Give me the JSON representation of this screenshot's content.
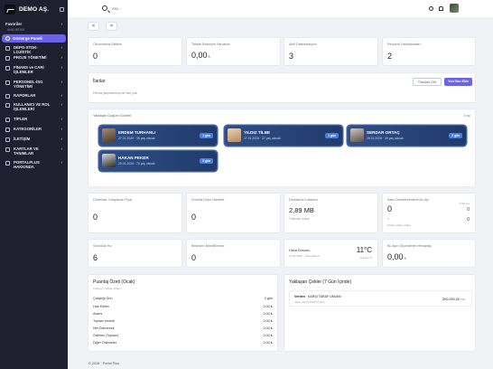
{
  "brand": {
    "name": "DEMO AŞ."
  },
  "sidebar": {
    "favorites": "Favoriler",
    "section_label": "ANA MENÜ",
    "active": "Gösterge Paneli",
    "items": [
      {
        "label": "DEPO-STOK-LOJİSTİK"
      },
      {
        "label": "PROJE YÖNETİMİ"
      },
      {
        "label": "FİNANS ve CARİ İŞLEMLER"
      },
      {
        "label": "PERSONEL-İSG YÖNETİMİ"
      },
      {
        "label": "RAPORLAR"
      },
      {
        "label": "KULLANICI VE ROL İŞLEMLERİ"
      },
      {
        "label": "TİPLER"
      },
      {
        "label": "KATEGORİLER"
      },
      {
        "label": "İLETİŞİM"
      },
      {
        "label": "KARTLAR VE TANIMLAR"
      },
      {
        "label": "PORTALPLUS HAKKINDA"
      }
    ]
  },
  "search": {
    "placeholder": "Ara..."
  },
  "nav": {
    "back": "«",
    "forward": "»"
  },
  "stats_top": [
    {
      "label": "Okunmamış Bildirim",
      "value": "0",
      "unit": ""
    },
    {
      "label": "Tahsile Bekleyen Harcama",
      "value": "0,00",
      "unit": "₺"
    },
    {
      "label": "Aktif Dakimatasyon",
      "value": "3",
      "unit": ""
    },
    {
      "label": "Personel Hatırlatmaları",
      "value": "2",
      "unit": ""
    }
  ],
  "announcements": {
    "title": "İlanlar",
    "empty_text": "Henüz yayınlanmış bir ilan yok",
    "btn_all": "Tümünü Gör",
    "btn_new": "Yeni İlan Ekle"
  },
  "birthdays": {
    "title": "Yaklaşan Doğum Günleri",
    "count": "4 kişi",
    "people": [
      {
        "name": "ERDEM TURHANLI",
        "date": "27.01.2026 · 35 yaş olacak",
        "badge": "1 gün"
      },
      {
        "name": "YILDIZ TİLBE",
        "date": "27.01.2026 · 37 yaş olacak",
        "badge": "1 gün"
      },
      {
        "name": "SERDAR ORTAÇ",
        "date": "28.01.2026 · 39 yaş olacak",
        "badge": "2 gün"
      },
      {
        "name": "HAKAN PEKER",
        "date": "29.01.2026 · 70 yaş olacak",
        "badge": "3 gün"
      }
    ]
  },
  "stats_mid": [
    {
      "label": "Dönemsiz Onaylanan Fiyat",
      "value": "0"
    },
    {
      "label": "Ürünlük Depo Hareketi",
      "value": "0"
    },
    {
      "label": "Depolama Kullanımı",
      "value": "2,89 MB",
      "sub": "Yüklenen dosya"
    },
    {
      "label": "Satın Denetlenenlerin Bu Ayı",
      "value": "0",
      "right_label": "Yükleme",
      "right_value": "0",
      "sub_value": "0",
      "sub_label": "Teslim edilen doğru"
    }
  ],
  "stats_low": [
    {
      "label": "Sözcülük Hız",
      "value": "6"
    },
    {
      "label": "Bekleyen Bilet/Bilmece",
      "value": "0"
    },
    {
      "label": "Hava Durumu",
      "sub": "27.01.2026 · Güncellendi",
      "temp": "11°C",
      "temp_sub": "Hava 1°C"
    },
    {
      "label": "Bu Ayın Ölçümlenen Hesaplaş",
      "value": "0,00",
      "unit": "₺"
    }
  ],
  "summary": {
    "title": "Puantaj Özeti (Ocak)",
    "subtitle": "Kullanıcı: Gökan Erdem",
    "rows": [
      {
        "k": "Çalıştığı Gün",
        "v": "0 gün"
      },
      {
        "k": "Hak Edilen",
        "v": "0,00 ₺"
      },
      {
        "k": "Avans",
        "v": "0,00 ₺"
      },
      {
        "k": "Toplam Kesinti",
        "v": "0,00 ₺"
      },
      {
        "k": "Net Ödenecek",
        "v": "0,00 ₺"
      },
      {
        "k": "Ödenen (Toplam)",
        "v": "0,00 ₺"
      },
      {
        "k": "Diğer Ödemeler",
        "v": "0,00 ₺"
      }
    ]
  },
  "cheques": {
    "title": "Yaklaşan Çekler (7 Gün İçinde)",
    "item_label": "Verilen",
    "item_party": "KARŞI TARAF ÜNVAN",
    "item_date": "Vade: 29.01.2026 (3 gün)",
    "item_amount": "300.000,00",
    "item_currency": "TRY"
  },
  "footer": {
    "text": "© 2026 · Portal Plus"
  }
}
